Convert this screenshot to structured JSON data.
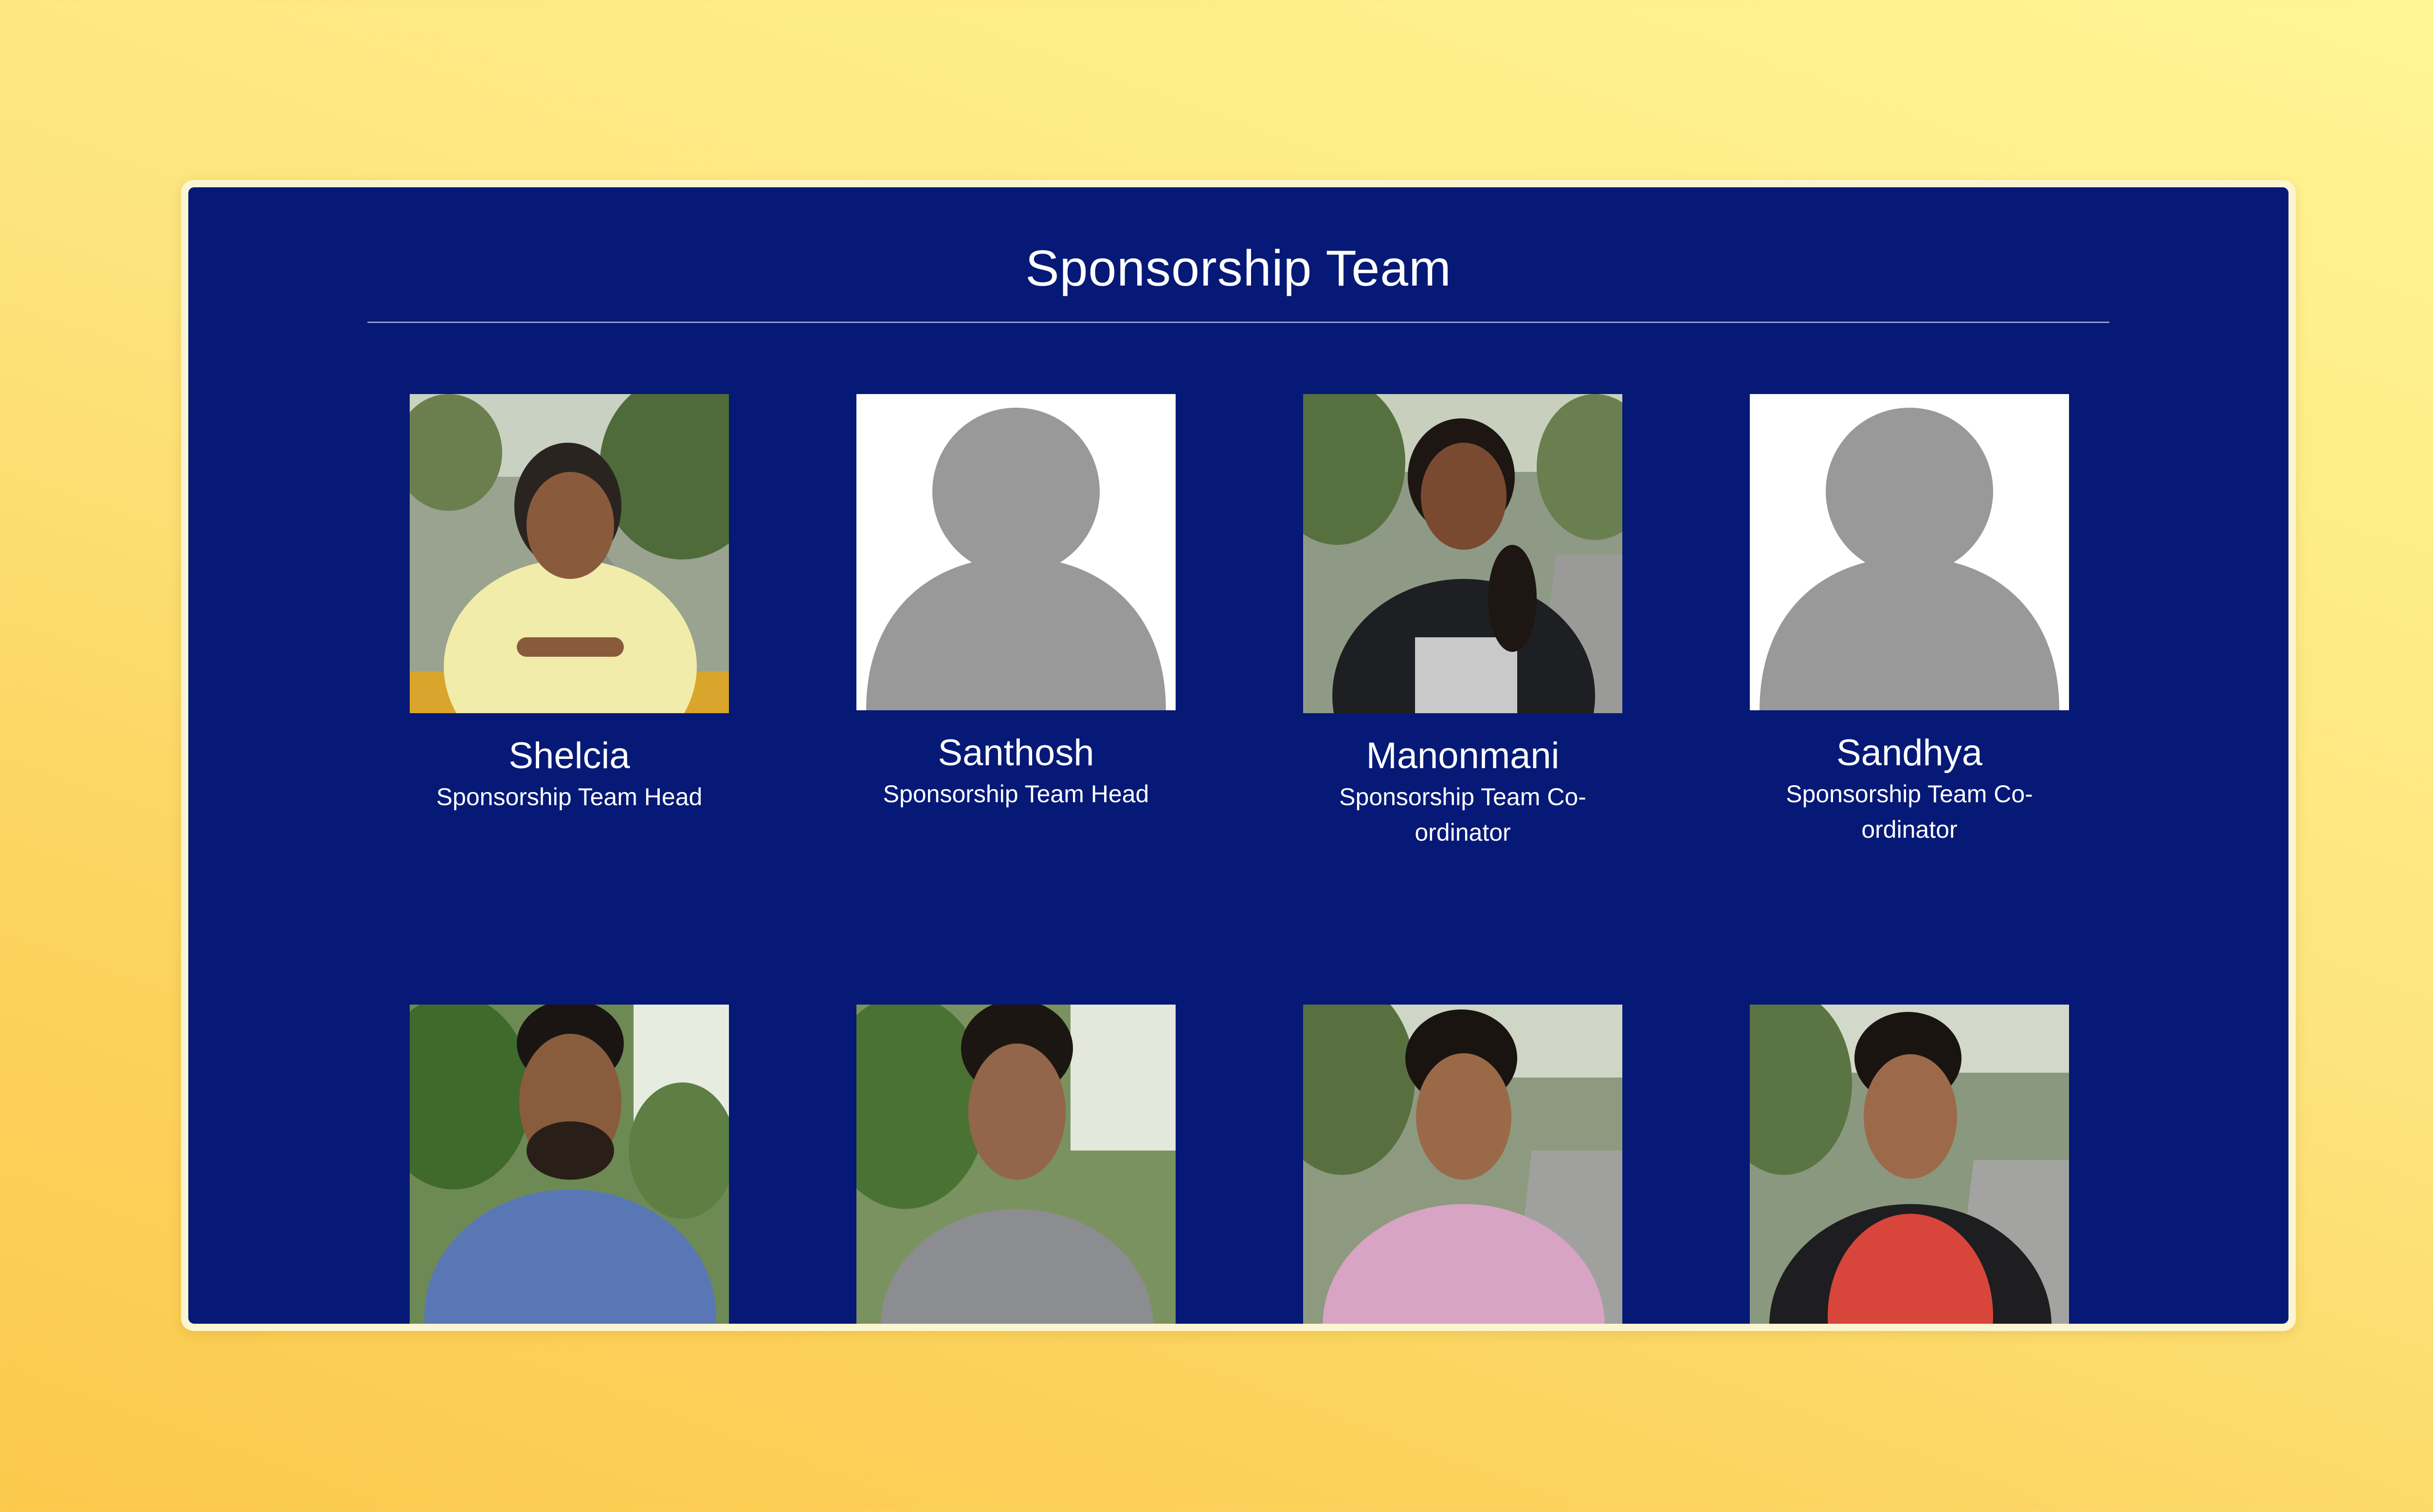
{
  "page": {
    "title": "Sponsorship Team"
  },
  "members": [
    {
      "name": "Shelcia",
      "role": "Sponsorship Team Head",
      "photo": "photo"
    },
    {
      "name": "Santhosh",
      "role": "Sponsorship Team Head",
      "photo": "placeholder-avatar"
    },
    {
      "name": "Manonmani",
      "role": "Sponsorship Team Co-ordinator",
      "photo": "photo"
    },
    {
      "name": "Sandhya",
      "role": "Sponsorship Team Co-ordinator",
      "photo": "placeholder-avatar"
    },
    {
      "name": "",
      "role": "",
      "photo": "photo"
    },
    {
      "name": "",
      "role": "",
      "photo": "photo"
    },
    {
      "name": "",
      "role": "",
      "photo": "photo"
    },
    {
      "name": "",
      "role": "",
      "photo": "photo"
    }
  ],
  "colors": {
    "panel": "#061976",
    "text": "#ffffff",
    "placeholder_bg": "#ffffff",
    "placeholder_figure": "#999999"
  }
}
